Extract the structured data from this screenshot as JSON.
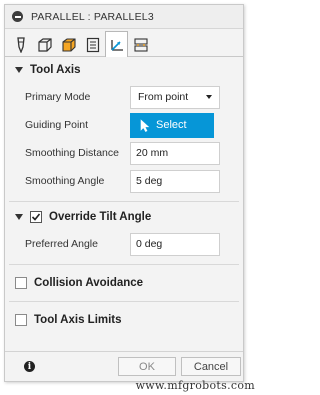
{
  "dialog": {
    "title": "PARALLEL : PARALLEL3",
    "tabs": [
      {
        "icon": "tool-icon",
        "active": false
      },
      {
        "icon": "geometry-icon",
        "active": false
      },
      {
        "icon": "heights-icon",
        "active": false
      },
      {
        "icon": "passes-icon",
        "active": false
      },
      {
        "icon": "multi-axis-icon",
        "active": true
      },
      {
        "icon": "linking-icon",
        "active": false
      }
    ]
  },
  "tool_axis": {
    "header": "Tool Axis",
    "primary_mode_label": "Primary Mode",
    "primary_mode_value": "From point",
    "guiding_point_label": "Guiding Point",
    "select_label": "Select",
    "smoothing_distance_label": "Smoothing Distance",
    "smoothing_distance_value": "20 mm",
    "smoothing_angle_label": "Smoothing Angle",
    "smoothing_angle_value": "5 deg"
  },
  "override_tilt": {
    "header": "Override Tilt Angle",
    "checked": true,
    "preferred_angle_label": "Preferred Angle",
    "preferred_angle_value": "0 deg"
  },
  "collision_avoidance": {
    "label": "Collision Avoidance",
    "checked": false
  },
  "tool_axis_limits": {
    "label": "Tool Axis Limits",
    "checked": false
  },
  "footer": {
    "ok_label": "OK",
    "cancel_label": "Cancel",
    "info_glyph": "i"
  },
  "watermark": "www.mfgrobots.com",
  "colors": {
    "accent": "#0696d7",
    "panel": "#f3f3f3"
  }
}
